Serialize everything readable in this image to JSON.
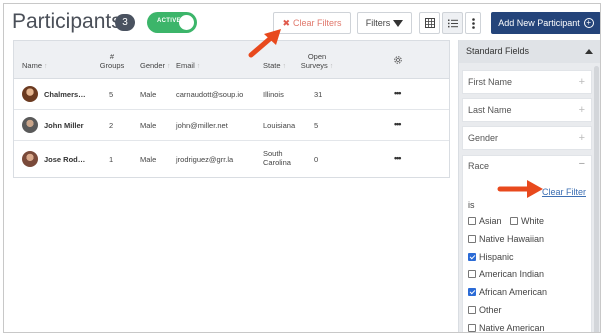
{
  "header": {
    "title": "Participants",
    "count": "3",
    "active_label": "ACTIVE",
    "clear_filters_label": "Clear Filters",
    "filters_label": "Filters",
    "add_button_label": "Add New Participant",
    "icons": {
      "clear": "x-icon",
      "filters": "funnel-icon",
      "grid": "grid-view-icon",
      "list": "list-view-icon",
      "more": "vertical-dots-icon",
      "add": "plus-circle-icon"
    }
  },
  "table": {
    "columns": [
      {
        "label": "Name"
      },
      {
        "label_line1": "#",
        "label_line2": "Groups"
      },
      {
        "label": "Gender"
      },
      {
        "label": "Email"
      },
      {
        "label": "State"
      },
      {
        "label_line1": "Open",
        "label_line2": "Surveys"
      }
    ],
    "rows": [
      {
        "name": "Chalmers…",
        "groups": "5",
        "gender": "Male",
        "email": "carnaudott@soup.io",
        "state": "Illinois",
        "state_line2": "",
        "surveys": "31",
        "actions": "•••"
      },
      {
        "name": "John Miller",
        "groups": "2",
        "gender": "Male",
        "email": "john@miller.net",
        "state": "Louisiana",
        "state_line2": "",
        "surveys": "5",
        "actions": "•••"
      },
      {
        "name": "Jose Rod…",
        "groups": "1",
        "gender": "Male",
        "email": "jrodriguez@grr.la",
        "state": "South",
        "state_line2": "Carolina",
        "surveys": "0",
        "actions": "•••"
      }
    ]
  },
  "panel": {
    "title": "Standard Fields",
    "fields": [
      "First Name",
      "Last Name",
      "Gender"
    ],
    "race": {
      "title": "Race",
      "clear_filter": "Clear Filter",
      "is_label": "is",
      "options": [
        {
          "label": "Asian",
          "checked": false
        },
        {
          "label": "White",
          "checked": false
        },
        {
          "label": "Native Hawaiian",
          "checked": false
        },
        {
          "label": "Hispanic",
          "checked": true
        },
        {
          "label": "American Indian",
          "checked": false
        },
        {
          "label": "African American",
          "checked": true
        },
        {
          "label": "Other",
          "checked": false
        },
        {
          "label": "Native American",
          "checked": false
        }
      ]
    }
  },
  "colors": {
    "primary": "#24447a",
    "active_green": "#3cb56a",
    "annotation_arrow": "#e8491d",
    "link": "#3d6fb3"
  }
}
